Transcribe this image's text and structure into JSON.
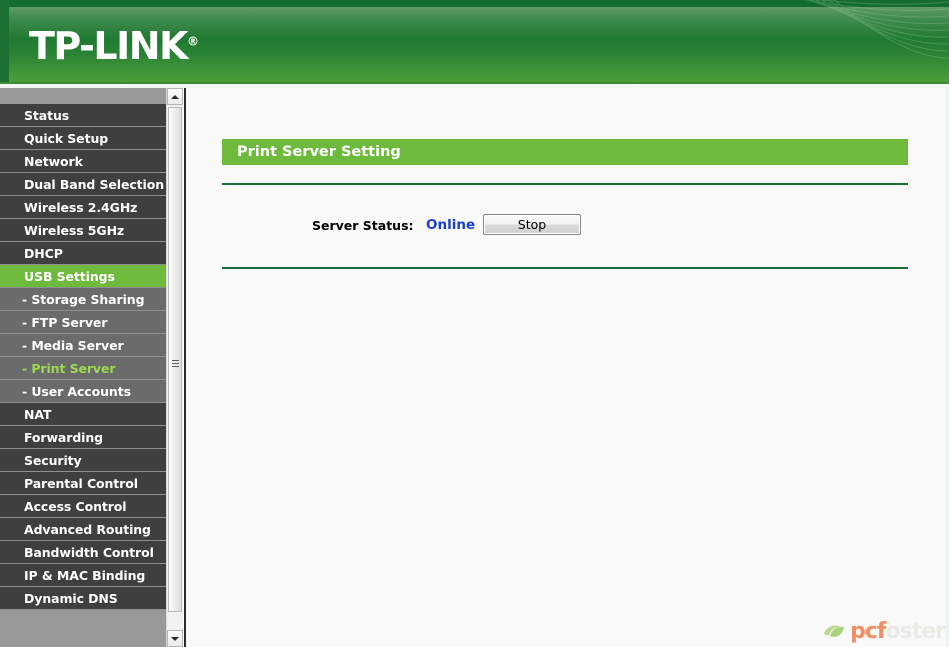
{
  "brand": {
    "logo_text": "TP-LINK",
    "logo_mark": "®"
  },
  "sidebar": {
    "items": [
      {
        "label": "Status",
        "type": "main",
        "state": "normal"
      },
      {
        "label": "Quick Setup",
        "type": "main",
        "state": "normal"
      },
      {
        "label": "Network",
        "type": "main",
        "state": "normal"
      },
      {
        "label": "Dual Band Selection",
        "type": "main",
        "state": "normal"
      },
      {
        "label": "Wireless 2.4GHz",
        "type": "main",
        "state": "normal"
      },
      {
        "label": "Wireless 5GHz",
        "type": "main",
        "state": "normal"
      },
      {
        "label": "DHCP",
        "type": "main",
        "state": "normal"
      },
      {
        "label": "USB Settings",
        "type": "main",
        "state": "active-parent"
      },
      {
        "label": "- Storage Sharing",
        "type": "sub",
        "state": "normal"
      },
      {
        "label": "- FTP Server",
        "type": "sub",
        "state": "normal"
      },
      {
        "label": "- Media Server",
        "type": "sub",
        "state": "normal"
      },
      {
        "label": "- Print Server",
        "type": "sub",
        "state": "active-sub"
      },
      {
        "label": "- User Accounts",
        "type": "sub",
        "state": "normal"
      },
      {
        "label": "NAT",
        "type": "main",
        "state": "normal"
      },
      {
        "label": "Forwarding",
        "type": "main",
        "state": "normal"
      },
      {
        "label": "Security",
        "type": "main",
        "state": "normal"
      },
      {
        "label": "Parental Control",
        "type": "main",
        "state": "normal"
      },
      {
        "label": "Access Control",
        "type": "main",
        "state": "normal"
      },
      {
        "label": "Advanced Routing",
        "type": "main",
        "state": "normal"
      },
      {
        "label": "Bandwidth Control",
        "type": "main",
        "state": "normal"
      },
      {
        "label": "IP & MAC Binding",
        "type": "main",
        "state": "normal"
      },
      {
        "label": "Dynamic DNS",
        "type": "main",
        "state": "normal"
      }
    ],
    "scrollbar": {
      "up_icon": "triangle-up-icon",
      "down_icon": "triangle-down-icon"
    }
  },
  "main": {
    "panel_title": "Print Server Setting",
    "status_label": "Server Status:",
    "status_value": "Online",
    "stop_button_label": "Stop"
  },
  "watermark": {
    "text_primary": "pcf",
    "text_secondary": "oster",
    "leaf_icon": "leaf-icon"
  },
  "colors": {
    "brand_green": "#1f7a31",
    "accent_green": "#6dba3c",
    "active_sub_text": "#9ed94f",
    "menu_bg": "#3f3f3f",
    "submenu_bg": "#6b6b6b",
    "status_blue": "#1a3fd0",
    "divider_green": "#1f6b36",
    "content_bg": "#f9f9f9",
    "sidebar_gutter": "#999999",
    "watermark_orange": "#f08a5d"
  }
}
